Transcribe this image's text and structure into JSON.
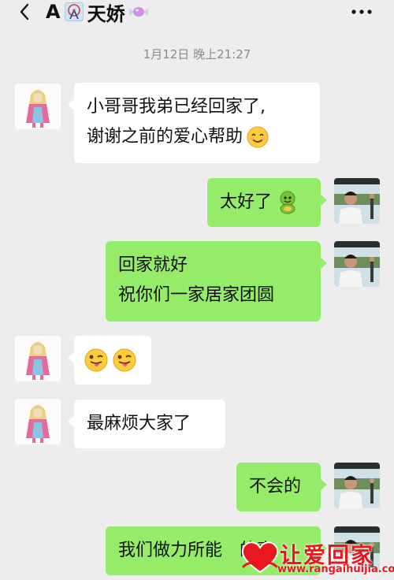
{
  "header": {
    "title_prefix": "A",
    "title_name": "天娇",
    "back_icon": "chevron-left-icon",
    "more_icon": "more-dots-icon"
  },
  "chat": {
    "timestamp": "1月12日 晚上21:27",
    "messages": [
      {
        "side": "left",
        "lines": [
          "小哥哥我弟已经回家了,",
          "谢谢之前的爱心帮助"
        ],
        "emoji": [
          "smiling-face"
        ]
      },
      {
        "side": "right",
        "lines": [
          "太好了"
        ],
        "emoji": [
          "green-figure"
        ]
      },
      {
        "side": "right",
        "lines": [
          "回家就好",
          "祝你们一家居家团圆"
        ]
      },
      {
        "side": "left",
        "lines": [
          ""
        ],
        "emoji": [
          "winking-tongue-face",
          "winking-tongue-face"
        ]
      },
      {
        "side": "left",
        "lines": [
          "最麻烦大家了"
        ]
      },
      {
        "side": "right",
        "lines": [
          "不会的"
        ]
      },
      {
        "side": "right",
        "lines": [
          "我们做力所能",
          "的事"
        ]
      }
    ]
  },
  "watermark": {
    "brand": "让爱回家",
    "url": "www.rangaihuijia.com"
  },
  "colors": {
    "background": "#ededed",
    "sent_bubble": "#95ec69",
    "received_bubble": "#ffffff",
    "watermark": "#e8191e"
  }
}
